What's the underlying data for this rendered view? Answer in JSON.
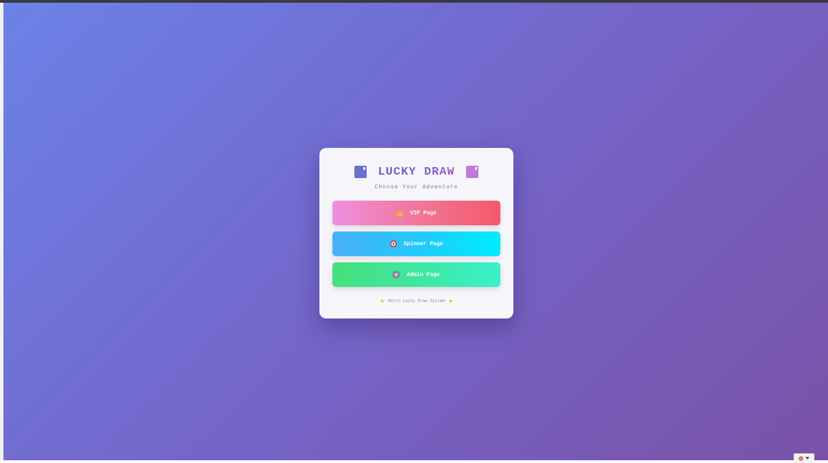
{
  "card": {
    "title": "LUCKY DRAW",
    "subtitle": "Choose Your Adventure",
    "left_icon": "book-icon",
    "right_icon": "book-icon"
  },
  "buttons": [
    {
      "label": "VIP Page",
      "icon": "crown-icon",
      "gradient": [
        "#ee8fe0",
        "#f45a6a"
      ]
    },
    {
      "label": "Spinner Page",
      "icon": "target-icon",
      "gradient": [
        "#4bb0f7",
        "#00edfe"
      ]
    },
    {
      "label": "Admin Page",
      "icon": "gear-icon",
      "gradient": [
        "#46e07c",
        "#3af1cb"
      ]
    }
  ],
  "footer": {
    "text": "Retro Lucky Draw System",
    "icon": "sparkle-icon"
  },
  "colors": {
    "background_start": "#6b82e8",
    "background_end": "#7a52a8",
    "card_background": "#f6f6fa",
    "title_color": "#6a5ccc"
  },
  "corner_widget": {
    "icon": "gear-icon"
  }
}
